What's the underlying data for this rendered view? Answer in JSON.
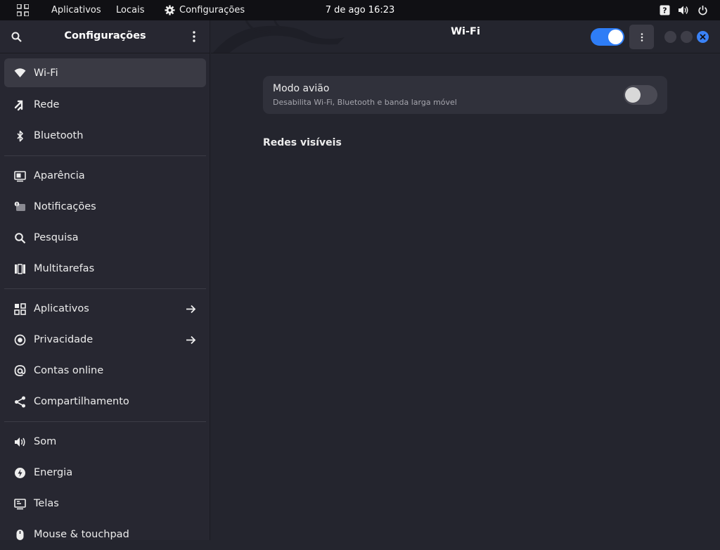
{
  "topbar": {
    "applications": "Aplicativos",
    "places": "Locais",
    "app_menu": "Configurações",
    "datetime": "7 de ago  16:23"
  },
  "sidebar": {
    "title": "Configurações",
    "groups": [
      [
        {
          "label": "Wi-Fi",
          "icon": "wifi-icon",
          "active": true
        },
        {
          "label": "Rede",
          "icon": "network-icon"
        },
        {
          "label": "Bluetooth",
          "icon": "bluetooth-icon"
        }
      ],
      [
        {
          "label": "Aparência",
          "icon": "appearance-icon"
        },
        {
          "label": "Notificações",
          "icon": "notifications-icon"
        },
        {
          "label": "Pesquisa",
          "icon": "search-icon"
        },
        {
          "label": "Multitarefas",
          "icon": "multitasking-icon"
        }
      ],
      [
        {
          "label": "Aplicativos",
          "icon": "apps-icon",
          "arrow": true
        },
        {
          "label": "Privacidade",
          "icon": "privacy-icon",
          "arrow": true
        },
        {
          "label": "Contas online",
          "icon": "at-icon"
        },
        {
          "label": "Compartilhamento",
          "icon": "share-icon"
        }
      ],
      [
        {
          "label": "Som",
          "icon": "sound-icon"
        },
        {
          "label": "Energia",
          "icon": "power-icon"
        },
        {
          "label": "Telas",
          "icon": "display-icon"
        },
        {
          "label": "Mouse & touchpad",
          "icon": "mouse-icon"
        }
      ]
    ]
  },
  "header": {
    "title": "Wi-Fi",
    "wifi_enabled": true
  },
  "airplane": {
    "title": "Modo avião",
    "subtitle": "Desabilita Wi-Fi, Bluetooth e banda larga móvel",
    "enabled": false
  },
  "networks": {
    "title": "Redes visíveis"
  },
  "colors": {
    "accent": "#2e7df6",
    "sidebar_bg": "#272731",
    "content_bg": "#24252e",
    "topbar_bg": "#101014"
  }
}
